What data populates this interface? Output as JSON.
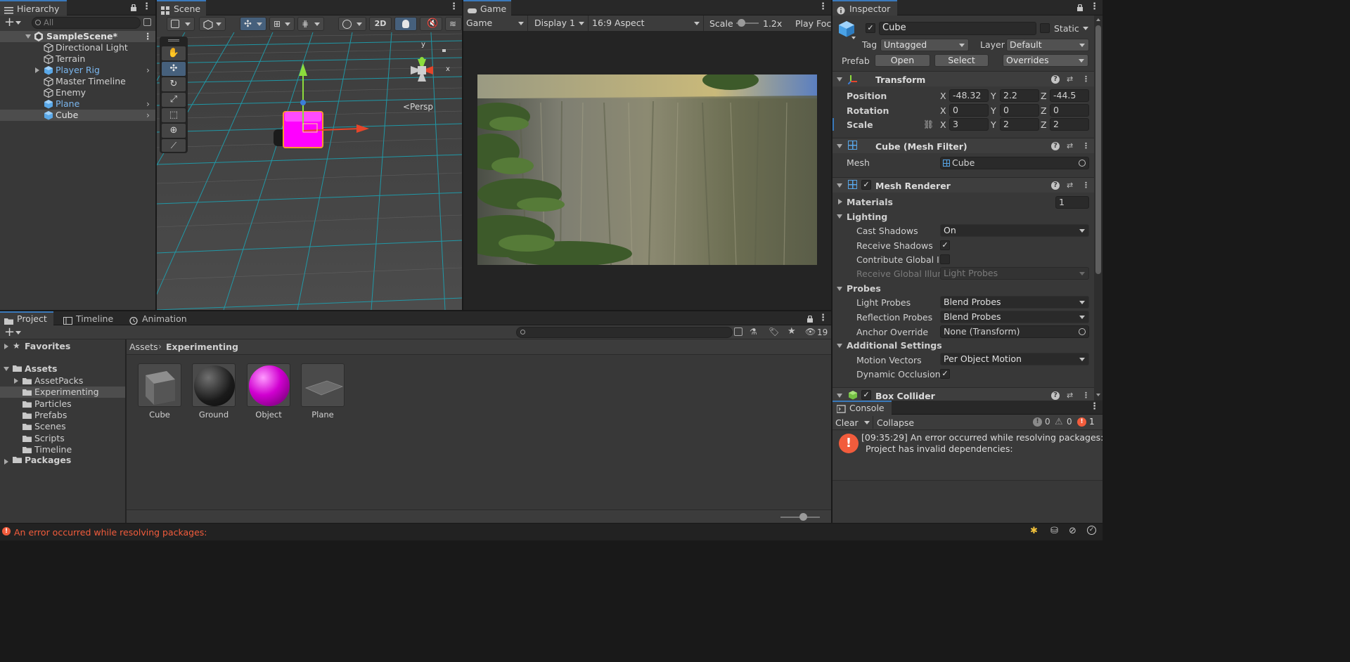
{
  "hierarchy": {
    "tab": "Hierarchy",
    "search_placeholder": "All",
    "scene": "SampleScene*",
    "items": [
      {
        "label": "Directional Light",
        "prefab": false,
        "expandable": false
      },
      {
        "label": "Terrain",
        "prefab": false,
        "expandable": false
      },
      {
        "label": "Player Rig",
        "prefab": true,
        "expandable": true
      },
      {
        "label": "Master Timeline",
        "prefab": false,
        "expandable": false
      },
      {
        "label": "Enemy",
        "prefab": false,
        "expandable": false
      },
      {
        "label": "Plane",
        "prefab": true,
        "expandable": false
      },
      {
        "label": "Cube",
        "prefab": true,
        "expandable": false
      }
    ]
  },
  "scene": {
    "tab": "Scene",
    "btn_2d": "2D",
    "persp_label": "<Persp",
    "gizmo_y": "y",
    "gizmo_x": "x"
  },
  "game": {
    "tab": "Game",
    "mode": "Game",
    "display": "Display 1",
    "aspect": "16:9 Aspect",
    "scale_label": "Scale",
    "scale_value": "1.2x",
    "play_focused": "Play Foc"
  },
  "inspector": {
    "tab": "Inspector",
    "object_name": "Cube",
    "static_label": "Static",
    "tag_label": "Tag",
    "tag_value": "Untagged",
    "layer_label": "Layer",
    "layer_value": "Default",
    "prefab_label": "Prefab",
    "open_btn": "Open",
    "select_btn": "Select",
    "overrides_btn": "Overrides",
    "transform": {
      "title": "Transform",
      "rows": [
        {
          "label": "Position",
          "x": "-48.32",
          "y": "2.2",
          "z": "-44.5"
        },
        {
          "label": "Rotation",
          "x": "0",
          "y": "0",
          "z": "0"
        },
        {
          "label": "Scale",
          "x": "3",
          "y": "2",
          "z": "2"
        }
      ],
      "axis_x": "X",
      "axis_y": "Y",
      "axis_z": "Z"
    },
    "mesh_filter": {
      "title": "Cube (Mesh Filter)",
      "mesh_label": "Mesh",
      "mesh_value": "Cube"
    },
    "mesh_renderer": {
      "title": "Mesh Renderer",
      "materials_label": "Materials",
      "materials_count": "1",
      "lighting_label": "Lighting",
      "cast_shadows_label": "Cast Shadows",
      "cast_shadows_value": "On",
      "receive_shadows_label": "Receive Shadows",
      "contribute_gi_label": "Contribute Global Ill",
      "receive_gi_label": "Receive Global Illun",
      "receive_gi_value": "Light Probes",
      "probes_label": "Probes",
      "light_probes_label": "Light Probes",
      "light_probes_value": "Blend Probes",
      "reflection_probes_label": "Reflection Probes",
      "reflection_probes_value": "Blend Probes",
      "anchor_override_label": "Anchor Override",
      "anchor_override_value": "None (Transform)",
      "additional_label": "Additional Settings",
      "motion_vectors_label": "Motion Vectors",
      "motion_vectors_value": "Per Object Motion",
      "dynamic_occlusion_label": "Dynamic Occlusion"
    },
    "box_collider": {
      "title": "Box Collider"
    }
  },
  "console": {
    "tab": "Console",
    "clear": "Clear",
    "collapse": "Collapse",
    "log_count": "0",
    "warn_count": "0",
    "error_count": "1",
    "message_line1": "[09:35:29] An error occurred while resolving packages:",
    "message_line2": "Project has invalid dependencies:"
  },
  "project": {
    "tabs": [
      "Project",
      "Timeline",
      "Animation"
    ],
    "hidden_count": "19",
    "favorites": "Favorites",
    "assets": "Assets",
    "folders": [
      "AssetPacks",
      "Experimenting",
      "Particles",
      "Prefabs",
      "Scenes",
      "Scripts",
      "Timeline"
    ],
    "packages": "Packages",
    "breadcrumb_root": "Assets",
    "breadcrumb_current": "Experimenting",
    "items": [
      "Cube",
      "Ground",
      "Object",
      "Plane"
    ]
  },
  "status": {
    "message": "An error occurred while resolving packages:"
  },
  "colors": {
    "accent": "#3a79bb",
    "error": "#f25c3c",
    "magenta": "#ff00ff",
    "selection": "#2c5d87"
  }
}
